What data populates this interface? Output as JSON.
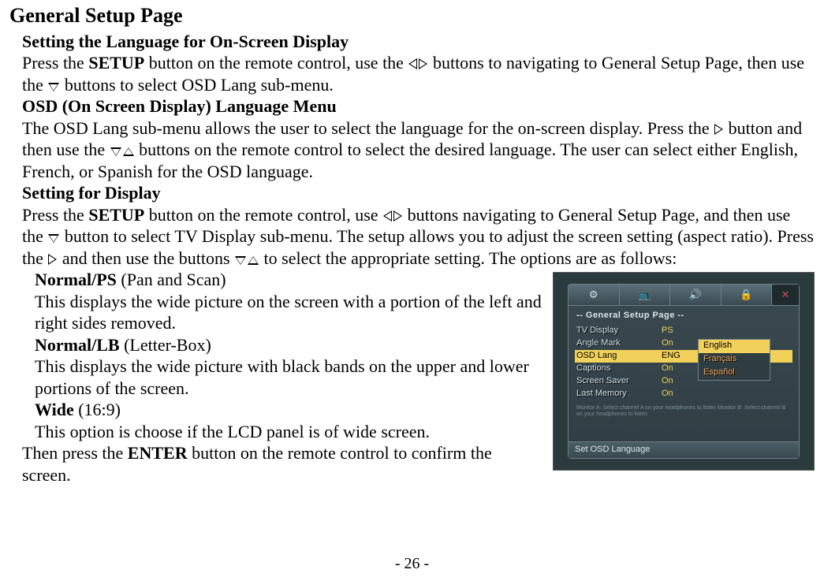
{
  "title": "General Setup Page",
  "section1_heading": "Setting the Language for On-Screen Display",
  "section1_p1a": "Press the ",
  "section1_p1b": "SETUP",
  "section1_p1c": " button on the remote control, use the",
  "section1_p1d": " buttons to navigating to General Setup Page, then use the ",
  "section1_p1e": " buttons to select OSD Lang sub-menu.",
  "section2_heading": "OSD (On Screen Display) Language Menu",
  "section2_p1a": "The OSD Lang sub-menu allows the user to select the language for the on-screen display. Press the",
  "section2_p1b": "button and then use the ",
  "section2_p1c": " buttons on the remote control to select the desired language. The user can select either English, French, or Spanish for the OSD language.",
  "section3_heading": "Setting for Display",
  "section3_p1a": "Press the ",
  "section3_p1b": "SETUP",
  "section3_p1c": " button on the remote control, use",
  "section3_p1d": "buttons navigating to General Setup Page, and then use the",
  "section3_p1e": " button to select TV Display sub-menu. The setup allows you to adjust the screen setting (aspect ratio). Press the",
  "section3_p1f": "and then use the buttons ",
  "section3_p1g": " to select the appropriate setting. The options are as follows:",
  "opt1_head": "Normal/PS",
  "opt1_head_tail": " (Pan and Scan)",
  "opt1_body": "This displays the wide picture on the screen with a portion of the left and right sides removed.",
  "opt2_head": "Normal/LB",
  "opt2_head_tail": " (Letter-Box)",
  "opt2_body": "This displays the wide picture with black bands on the upper and lower portions of the screen.",
  "opt3_head": "Wide",
  "opt3_head_tail": " (16:9)",
  "opt3_body": "This option is choose if the LCD panel is of wide screen.",
  "closing_a": "Then press the ",
  "closing_b": "ENTER",
  "closing_c": " button on the remote control to confirm the screen.",
  "page_number": "- 26 -",
  "osd": {
    "title": "-- General Setup Page --",
    "rows": [
      {
        "label": "TV Display",
        "value": "PS"
      },
      {
        "label": "Angle Mark",
        "value": "On"
      },
      {
        "label": "OSD Lang",
        "value": "ENG"
      },
      {
        "label": "Captions",
        "value": "On"
      },
      {
        "label": "Screen Saver",
        "value": "On"
      },
      {
        "label": "Last Memory",
        "value": "On"
      }
    ],
    "options": [
      "English",
      "Français",
      "Español"
    ],
    "status": "Set OSD Language",
    "tabs": [
      "⚙",
      "📺",
      "🔊",
      "🔒"
    ],
    "hint": "Monitor A: Select channel A on your headphones to listen\nMonitor B: Select channel B on your headphones to listen"
  }
}
